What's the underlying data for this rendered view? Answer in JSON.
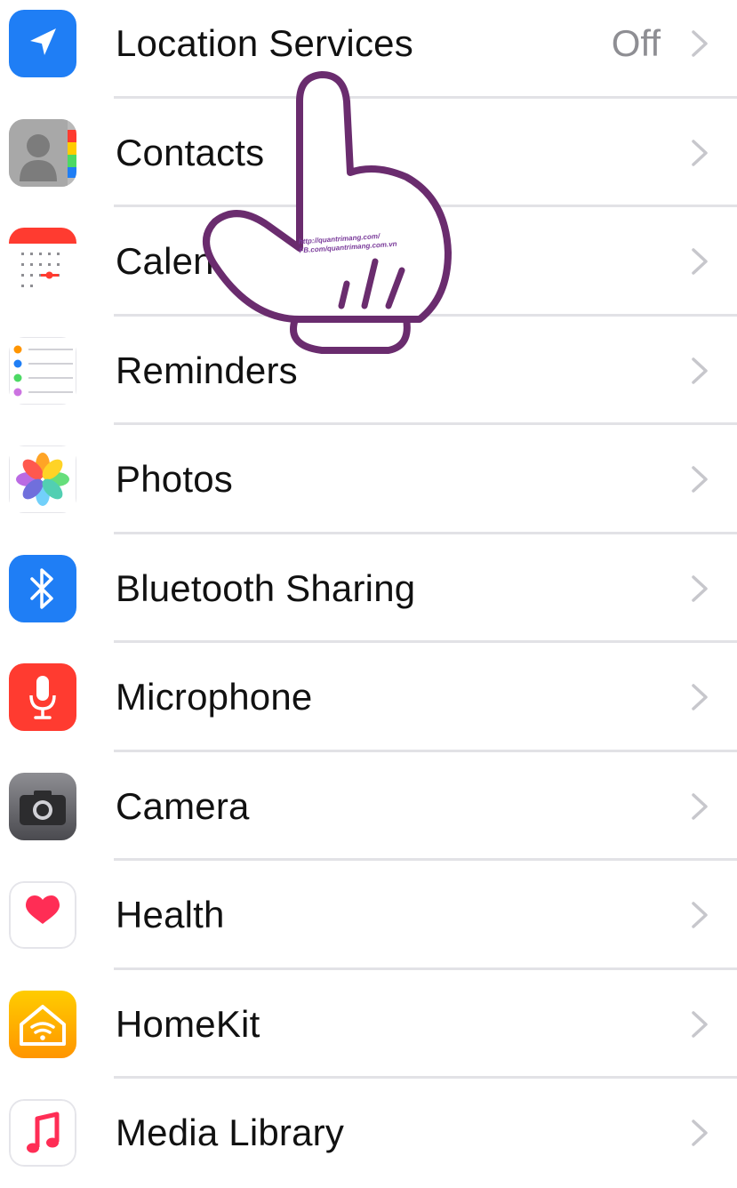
{
  "privacy_list": {
    "items": [
      {
        "label": "Location Services",
        "value": "Off",
        "icon": "location-arrow-icon",
        "color": "#1f7ef5"
      },
      {
        "label": "Contacts",
        "value": "",
        "icon": "contacts-icon",
        "color": "#9a9a9a"
      },
      {
        "label": "Calendars",
        "value": "",
        "icon": "calendar-icon",
        "color": "#ff3b30"
      },
      {
        "label": "Reminders",
        "value": "",
        "icon": "reminders-icon",
        "color": "#ffffff"
      },
      {
        "label": "Photos",
        "value": "",
        "icon": "photos-icon",
        "color": "#ffffff"
      },
      {
        "label": "Bluetooth Sharing",
        "value": "",
        "icon": "bluetooth-icon",
        "color": "#1f7ef5"
      },
      {
        "label": "Microphone",
        "value": "",
        "icon": "microphone-icon",
        "color": "#ff3b30"
      },
      {
        "label": "Camera",
        "value": "",
        "icon": "camera-icon",
        "color": "#6e6e73"
      },
      {
        "label": "Health",
        "value": "",
        "icon": "health-heart-icon",
        "color": "#ff2d55"
      },
      {
        "label": "HomeKit",
        "value": "",
        "icon": "homekit-icon",
        "color": "#ffb300"
      },
      {
        "label": "Media Library",
        "value": "",
        "icon": "media-library-icon",
        "color": "#ff2d55"
      }
    ]
  },
  "overlay": {
    "pointer_icon": "hand-pointer-icon",
    "watermark_line1": "http://quantrimang.com/",
    "watermark_line2": "FB.com/quantrimang.com.vn"
  }
}
